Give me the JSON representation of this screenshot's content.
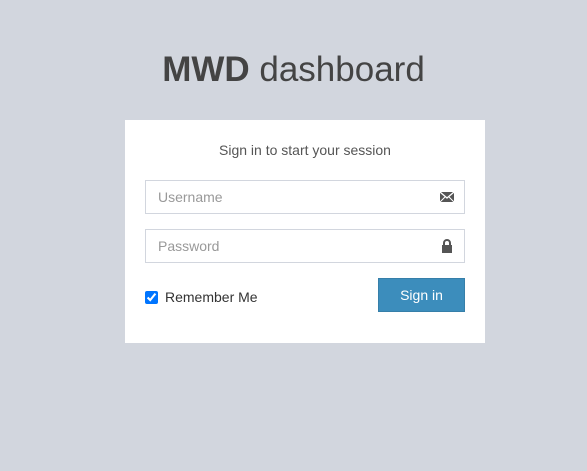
{
  "logo": {
    "brand": "MWD",
    "suffix": " dashboard"
  },
  "login": {
    "message": "Sign in to start your session",
    "username_placeholder": "Username",
    "password_placeholder": "Password",
    "remember_label": "Remember Me",
    "remember_checked": true,
    "submit_label": "Sign in"
  },
  "colors": {
    "background": "#d2d6de",
    "primary_button": "#3c8dbc"
  },
  "icons": {
    "username": "envelope-icon",
    "password": "lock-icon"
  }
}
